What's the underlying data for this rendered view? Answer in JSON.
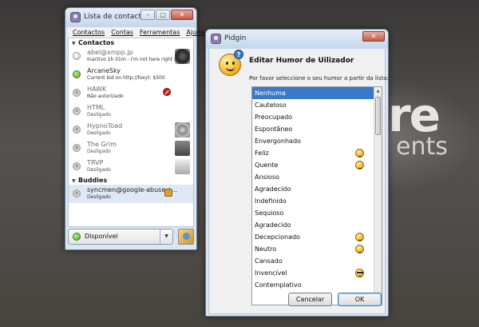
{
  "desktop": {
    "big_text": "re",
    "small_text": "ents"
  },
  "buddy_list": {
    "title": "Lista de contactos",
    "window_buttons": [
      "–",
      "▢",
      "✕"
    ],
    "menu": [
      "Contactos",
      "Contas",
      "Ferramentas",
      "Ajuda"
    ],
    "groups": [
      {
        "name": "Contactos",
        "contacts": [
          {
            "name": "abel@xmpp.jp",
            "status": "Inactivo 1h 01m - I'm not here right n...",
            "state": "idle"
          },
          {
            "name": "ArcaneSky",
            "status": "Current bid on http://foxyt: $500",
            "state": "online"
          },
          {
            "name": "HAWK",
            "status": "Não autorizado",
            "state": "offline"
          },
          {
            "name": "HTML",
            "status": "Desligado",
            "state": "offline"
          },
          {
            "name": "HypnoToad",
            "status": "Desligado",
            "state": "offline"
          },
          {
            "name": "The Grim",
            "status": "Desligado",
            "state": "offline"
          },
          {
            "name": "TRVP",
            "status": "Desligado",
            "state": "offline"
          }
        ]
      },
      {
        "name": "Buddies",
        "contacts": [
          {
            "name": "syncmen@google-abuse.o...",
            "status": "Desligado",
            "state": "offline"
          }
        ]
      }
    ],
    "status_selector": {
      "value": "Disponível"
    }
  },
  "mood_dialog": {
    "title": "Pidgin",
    "window_buttons": [
      "✕"
    ],
    "heading": "Editar Humor de Uilizador",
    "prompt": "Por favor seleccione o seu humor a partir da lista:",
    "moods": [
      {
        "label": "Nenhuma",
        "selected": true,
        "emoticon": ""
      },
      {
        "label": "Cauteloso",
        "emoticon": ""
      },
      {
        "label": "Preocupado",
        "emoticon": ""
      },
      {
        "label": "Espontâneo",
        "emoticon": ""
      },
      {
        "label": "Envergonhado",
        "emoticon": ""
      },
      {
        "label": "Feliz",
        "emoticon": "happy"
      },
      {
        "label": "Quente",
        "emoticon": "hot"
      },
      {
        "label": "Ansioso",
        "emoticon": ""
      },
      {
        "label": "Agradecido",
        "emoticon": ""
      },
      {
        "label": "Indefinido",
        "emoticon": ""
      },
      {
        "label": "Sequioso",
        "emoticon": ""
      },
      {
        "label": "Agradecido",
        "emoticon": ""
      },
      {
        "label": "Decepcionado",
        "emoticon": "sad"
      },
      {
        "label": "Neutro",
        "emoticon": "neutral"
      },
      {
        "label": "Cansado",
        "emoticon": ""
      },
      {
        "label": "Invencível",
        "emoticon": "cool"
      },
      {
        "label": "Contemplativo",
        "emoticon": ""
      }
    ],
    "buttons": {
      "cancel": "Cancelar",
      "ok": "OK"
    }
  },
  "colors": {
    "selection": "#3b78c9",
    "online": "#4aa320",
    "titlebar": "#c4d6ea"
  }
}
